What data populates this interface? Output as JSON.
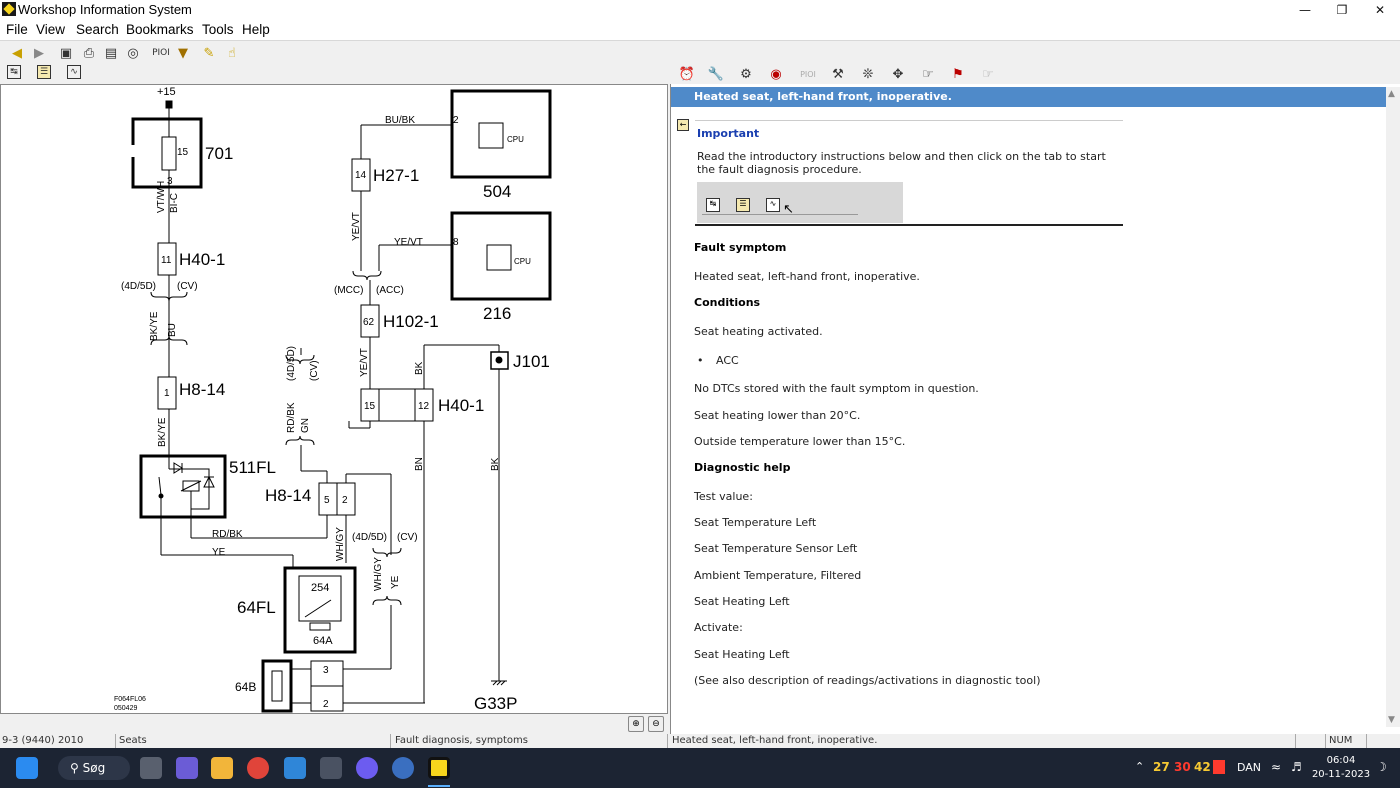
{
  "window": {
    "title": "Workshop Information System",
    "minimize_icon": "minimize-icon",
    "maximize_icon": "restore-icon",
    "close_icon": "close-icon"
  },
  "menu": [
    "File",
    "View",
    "Search",
    "Bookmarks",
    "Tools",
    "Help"
  ],
  "toolbar_pioi": "PIOI",
  "diagram": {
    "top_label": "+15",
    "components": {
      "c701": "701",
      "c504": "504",
      "c216": "216",
      "cpu1": "CPU",
      "cpu2": "CPU",
      "h27": "H27-1",
      "h40a": "H40-1",
      "h40b": "H40-1",
      "h102": "H102-1",
      "h8a": "H8-14",
      "h8b": "H8-14",
      "j101": "J101",
      "c511": "511FL",
      "c64fl": "64FL",
      "c64a": "64A",
      "c64b": "64B",
      "c254": "254",
      "g33p": "G33P"
    },
    "pins": {
      "p15": "15",
      "p3": "3",
      "p11": "11",
      "p1": "1",
      "p14": "14",
      "p2": "2",
      "p8": "8",
      "p62": "62",
      "p15b": "15",
      "p12": "12",
      "p5": "5",
      "p2b": "2",
      "p3b": "3",
      "p2c": "2"
    },
    "wires": {
      "w_vtwh": "VT/WH",
      "w_bic": "BI-C",
      "w_4d5d_a": "(4D/5D)",
      "w_cv_a": "(CV)",
      "w_bkye": "BK/YE",
      "w_bu": "BU",
      "w_bkye2": "BK/YE",
      "w_bubk": "BU/BK",
      "w_yevt1": "YE/VT",
      "w_yevt2": "YE/VT",
      "w_mcc": "(MCC)",
      "w_acc": "(ACC)",
      "w_yevt3": "YE/VT",
      "w_bk1": "BK",
      "w_rdbk": "RD/BK",
      "w_gn": "GN",
      "w_4d5d_b": "(4D/5D)",
      "w_cv_b": "(CV)",
      "w_bn": "BN",
      "w_bk2": "BK",
      "w_rdbk2": "RD/BK",
      "w_ye": "YE",
      "w_whgy": "WH/GY",
      "w_4d5d_c": "(4D/5D)",
      "w_cv_c": "(CV)",
      "w_whgy2": "WH/GY",
      "w_ye2": "YE"
    },
    "ref1": "F064FL06",
    "ref2": "050429"
  },
  "right": {
    "header": "Heated seat, left-hand front, inoperative.",
    "important_title": "Important",
    "important_text1": "Read the introductory instructions below and then click on the tab to start",
    "important_text2": "the fault diagnosis procedure.",
    "fault_symptom_heading": "Fault symptom",
    "fault_symptom_text": "Heated seat, left-hand front, inoperative.",
    "conditions_heading": "Conditions",
    "conditions_text": "Seat heating activated.",
    "bullet": "ACC",
    "no_dtc": "No DTCs stored with the fault symptom in question.",
    "seat_lower": "Seat heating lower than 20°C.",
    "outside_lower": "Outside temperature lower than 15°C.",
    "diag_heading": "Diagnostic help",
    "test_value": "Test value:",
    "tv1": "Seat Temperature Left",
    "tv2": "Seat Temperature Sensor Left",
    "tv3": "Ambient Temperature, Filtered",
    "tv4": "Seat Heating Left",
    "activate": "Activate:",
    "act1": "Seat Heating Left",
    "see_also": "(See also description of readings/activations in diagnostic tool)"
  },
  "status": {
    "s1": "9-3 (9440) 2010",
    "s2": "Seats",
    "s3": "Fault diagnosis, symptoms",
    "s4": "Heated seat, left-hand front, inoperative.",
    "s5": "NUM"
  },
  "taskbar": {
    "search": "Søg",
    "w1": "27",
    "w2": "30",
    "w3": "42",
    "lang": "DAN",
    "time": "06:04",
    "date": "20-11-2023"
  },
  "colors": {
    "header_blue": "#4f8ac9",
    "important_blue": "#1a3fb0",
    "taskbar": "#1c2433"
  }
}
